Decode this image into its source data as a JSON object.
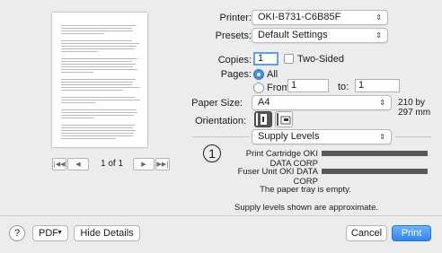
{
  "preview": {
    "page_text": "1 of 1"
  },
  "form": {
    "printer_label": "Printer:",
    "printer_value": "OKI-B731-C6B85F",
    "presets_label": "Presets:",
    "presets_value": "Default Settings",
    "copies_label": "Copies:",
    "copies_value": "1",
    "two_sided_label": "Two-Sided",
    "pages_label": "Pages:",
    "pages_all_label": "All",
    "pages_from_label": "From:",
    "pages_from_value": "1",
    "pages_to_label": "to:",
    "pages_to_value": "1",
    "paper_size_label": "Paper Size:",
    "paper_size_value": "A4",
    "paper_size_dims": "210 by 297 mm",
    "orientation_label": "Orientation:",
    "section_value": "Supply Levels"
  },
  "supply": {
    "badge": "1",
    "items": [
      {
        "label": "Print Cartridge OKI DATA CORP",
        "level": 1.0
      },
      {
        "label": "Fuser Unit OKI DATA CORP",
        "level": 1.0
      }
    ],
    "tray_message": "The paper tray is empty.",
    "approx_message": "Supply levels shown are approximate."
  },
  "footer": {
    "help_label": "?",
    "pdf_label": "PDF",
    "hide_details_label": "Hide Details",
    "cancel_label": "Cancel",
    "print_label": "Print"
  },
  "colors": {
    "accent": "#3a8ff0",
    "level_bar": "#585858"
  }
}
